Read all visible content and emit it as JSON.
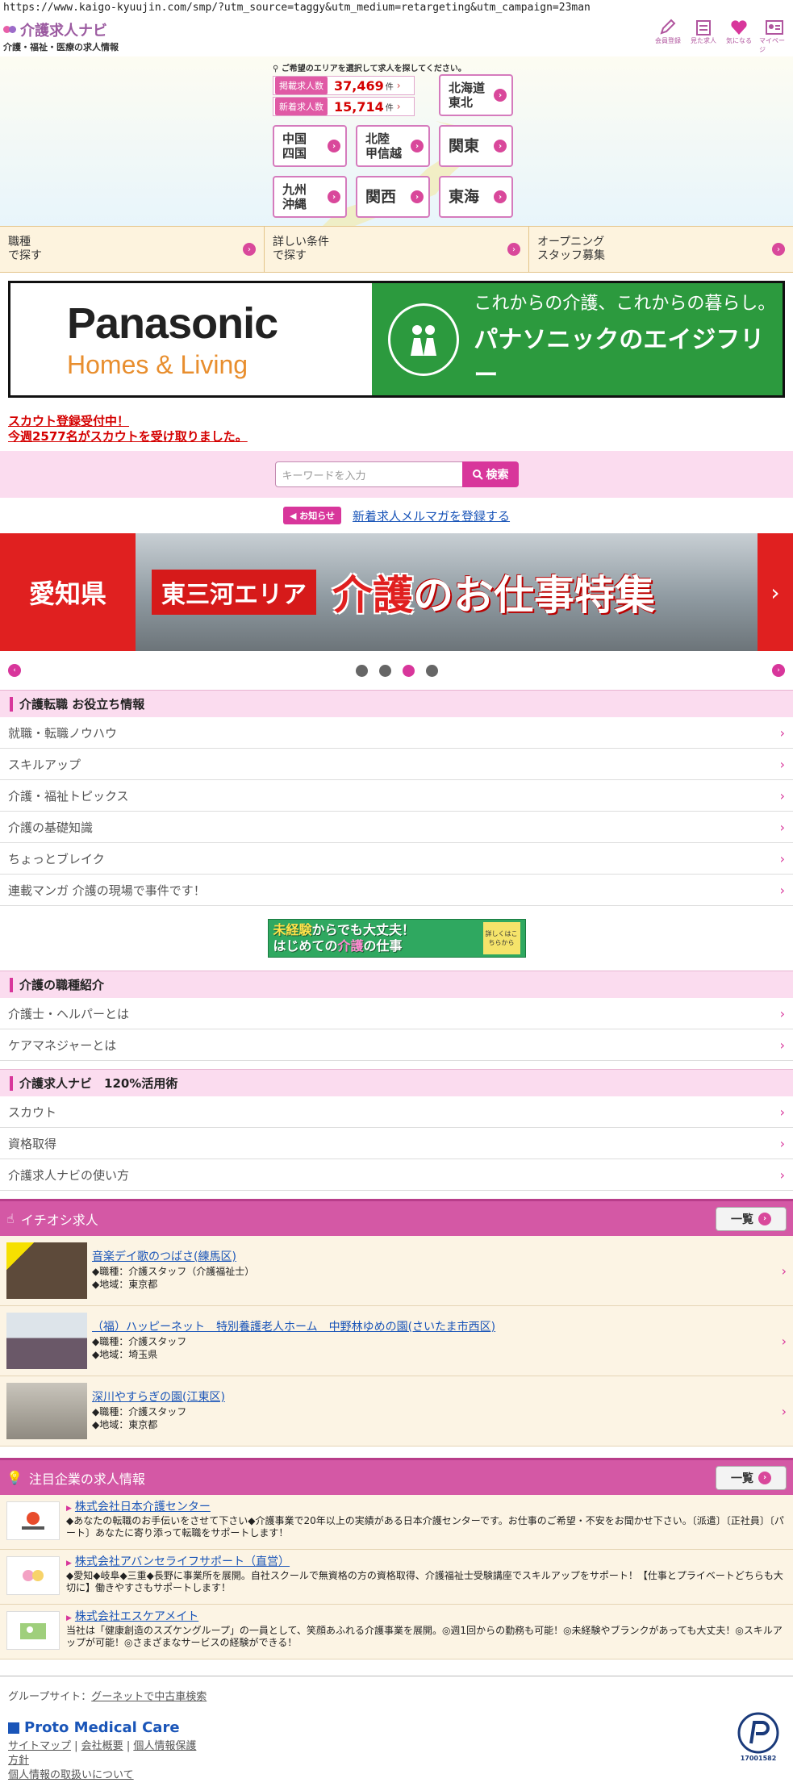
{
  "browser": {
    "url": "https://www.kaigo-kyuujin.com/smp/?utm_source=taggy&utm_medium=retargeting&utm_campaign=23man"
  },
  "header": {
    "logo_title": "介護求人ナビ",
    "logo_sub": "介護・福祉・医療の求人情報",
    "icons": [
      {
        "label": "会員登録",
        "icon": "pencil-icon"
      },
      {
        "label": "見た求人",
        "icon": "calendar-icon"
      },
      {
        "label": "気になる",
        "icon": "heart-icon"
      },
      {
        "label": "マイページ",
        "icon": "person-icon"
      }
    ]
  },
  "area": {
    "hint": "ご希望のエリアを選択して求人を探してください。",
    "stats": [
      {
        "label": "掲載求人数",
        "value": "37,469",
        "unit": "件"
      },
      {
        "label": "新着求人数",
        "value": "15,714",
        "unit": "件"
      }
    ],
    "regions": {
      "hokkaido": [
        "北海道",
        "東北"
      ],
      "chugoku": [
        "中国",
        "四国"
      ],
      "hokuriku": [
        "北陸",
        "甲信越"
      ],
      "kanto": "関東",
      "kyushu": [
        "九州",
        "沖縄"
      ],
      "kansai": "関西",
      "tokai": "東海"
    }
  },
  "search_tabs": [
    "職種\nで探す",
    "詳しい条件\nで探す",
    "オープニング\nスタッフ募集"
  ],
  "ad": {
    "brand": "Panasonic",
    "sub": "Homes & Living",
    "tagline": "これからの介護、これからの暮らし。",
    "headline": "パナソニックのエイジフリー"
  },
  "scout": {
    "line1": "スカウト登録受付中！",
    "line2": "今週2577名がスカウトを受け取りました。"
  },
  "keyword": {
    "placeholder": "キーワードを入力",
    "button": "検索"
  },
  "notice": {
    "badge": "お知らせ",
    "link": "新着求人メルマガを登録する"
  },
  "slider": {
    "pref": "愛知県",
    "area": "東三河エリア",
    "title_a": "介護",
    "title_b": "のお仕事特集",
    "dots": 4,
    "active_dot": 2
  },
  "tips": {
    "title": "介護転職 お役立ち情報",
    "items": [
      "就職・転職ノウハウ",
      "スキルアップ",
      "介護・福祉トピックス",
      "介護の基礎知識",
      "ちょっとブレイク",
      "連載マンガ 介護の現場で事件です！"
    ]
  },
  "mikeiken": {
    "l1a": "未経験",
    "l1b": "からでも大丈夫！",
    "l2a": "はじめての",
    "l2b": "介護",
    "l2c": "の仕事",
    "badge": "詳しくはこちらから"
  },
  "jobtypes": {
    "title": "介護の職種紹介",
    "items": [
      "介護士・ヘルパーとは",
      "ケアマネジャーとは"
    ]
  },
  "usage": {
    "title": "介護求人ナビ　120%活用術",
    "items": [
      "スカウト",
      "資格取得",
      "介護求人ナビの使い方"
    ]
  },
  "featured": {
    "title": "イチオシ求人",
    "more": "一覧",
    "jobs": [
      {
        "name": "音楽デイ歌のつばさ(練馬区)",
        "role": "◆職種：介護スタッフ（介護福祉士）",
        "area": "◆地域：東京都"
      },
      {
        "name": "（福）ハッピーネット　特別養護老人ホーム　中野林ゆめの園(さいたま市西区)",
        "role": "◆職種：介護スタッフ",
        "area": "◆地域：埼玉県"
      },
      {
        "name": "深川やすらぎの園(江東区)",
        "role": "◆職種：介護スタッフ",
        "area": "◆地域：東京都"
      }
    ]
  },
  "companies": {
    "title": "注目企業の求人情報",
    "more": "一覧",
    "items": [
      {
        "name": "株式会社日本介護センター",
        "desc": "◆あなたの転職のお手伝いをさせて下さい◆介護事業で20年以上の実績がある日本介護センターです。お仕事のご希望・不安をお聞かせ下さい。〔派遣〕〔正社員〕〔パート〕あなたに寄り添って転職をサポートします！"
      },
      {
        "name": "株式会社アバンセライフサポート（直営）",
        "desc": "◆愛知◆岐阜◆三重◆長野に事業所を展開。自社スクールで無資格の方の資格取得、介護福祉士受験講座でスキルアップをサポート！【仕事とプライベートどちらも大切に】働きやすさもサポートします！"
      },
      {
        "name": "株式会社エスケアメイト",
        "desc": "当社は「健康創造のスズケングループ」の一員として、笑顔あふれる介護事業を展開。◎週1回からの勤務も可能！◎未経験やブランクがあっても大丈夫！◎スキルアップが可能！◎さまざまなサービスの経験ができる！"
      }
    ]
  },
  "footer": {
    "group_label": "グループサイト：",
    "group_link": "グーネットで中古車検索",
    "company": "Proto Medical Care",
    "links": [
      "サイトマップ",
      "会社概要",
      "個人情報保護",
      "方針",
      "個人情報の取扱いについて"
    ],
    "privacy_number": "17001582"
  },
  "colors": {
    "accent": "#d8369b",
    "band": "#d458a5",
    "link": "#1a55b8",
    "alert": "#d40000"
  }
}
